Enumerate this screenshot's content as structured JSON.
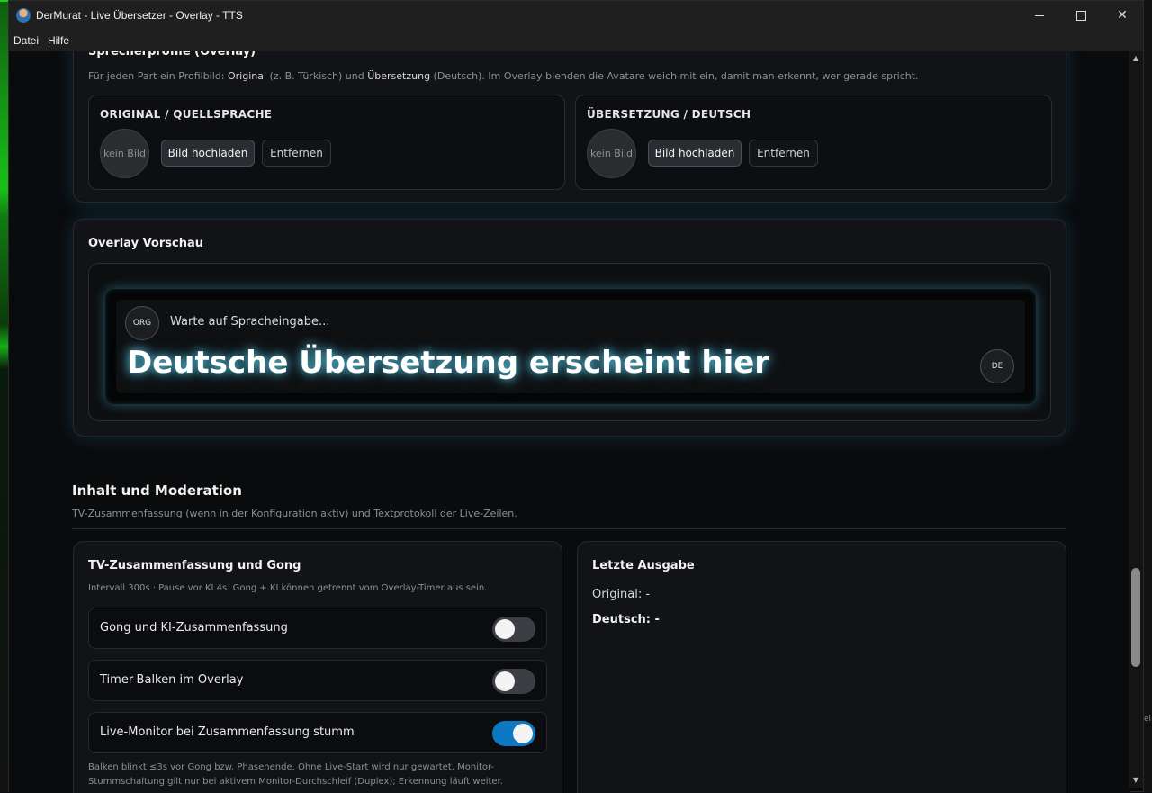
{
  "window": {
    "title": "DerMurat - Live Übersetzer - Overlay - TTS",
    "min": "",
    "max": "",
    "close": "✕"
  },
  "menu": {
    "items": [
      "Datei",
      "Hilfe"
    ]
  },
  "speaker_section": {
    "title_partial": "Sprecherprofile (Overlay)",
    "hint_prefix": "Für jeden Part ein Profilbild: ",
    "hint_original": "Original",
    "hint_mid1": " (z. B. Türkisch) und ",
    "hint_translation": "Übersetzung",
    "hint_rest": " (Deutsch). Im Overlay blenden die Avatare weich mit ein, damit man erkennt, wer gerade spricht.",
    "original": {
      "title": "ORIGINAL / QUELLSPRACHE",
      "placeholder": "kein Bild",
      "upload": "Bild hochladen",
      "remove": "Entfernen"
    },
    "translation": {
      "title": "ÜBERSETZUNG / DEUTSCH",
      "placeholder": "kein Bild",
      "upload": "Bild hochladen",
      "remove": "Entfernen"
    }
  },
  "preview": {
    "title": "Overlay Vorschau",
    "org_badge": "ORG",
    "waiting": "Warte auf Spracheingabe...",
    "translation_line": "Deutsche Übersetzung erscheint hier",
    "de_badge": "DE"
  },
  "moderation": {
    "title": "Inhalt und Moderation",
    "subtitle": "TV-Zusammenfassung (wenn in der Konfiguration aktiv) und Textprotokoll der Live-Zeilen.",
    "tv": {
      "title": "TV-Zusammenfassung und Gong",
      "hint": "Intervall 300s · Pause vor KI 4s. Gong + KI können getrennt vom Overlay-Timer aus sein.",
      "toggles": [
        {
          "label": "Gong und KI-Zusammenfassung",
          "on": false
        },
        {
          "label": "Timer-Balken im Overlay",
          "on": false
        },
        {
          "label": "Live-Monitor bei Zusammenfassung stumm",
          "on": true
        }
      ],
      "footnote": "Balken blinkt ≤3s vor Gong bzw. Phasenende. Ohne Live-Start wird nur gewartet. Monitor-Stummschaltung gilt nur bei aktivem Monitor-Durchschleif (Duplex); Erkennung läuft weiter."
    },
    "last_output": {
      "title": "Letzte Ausgabe",
      "original": "Original: -",
      "german": "Deutsch: -"
    }
  },
  "scroll": {
    "up": "▲",
    "down": "▼"
  },
  "edge": "el"
}
